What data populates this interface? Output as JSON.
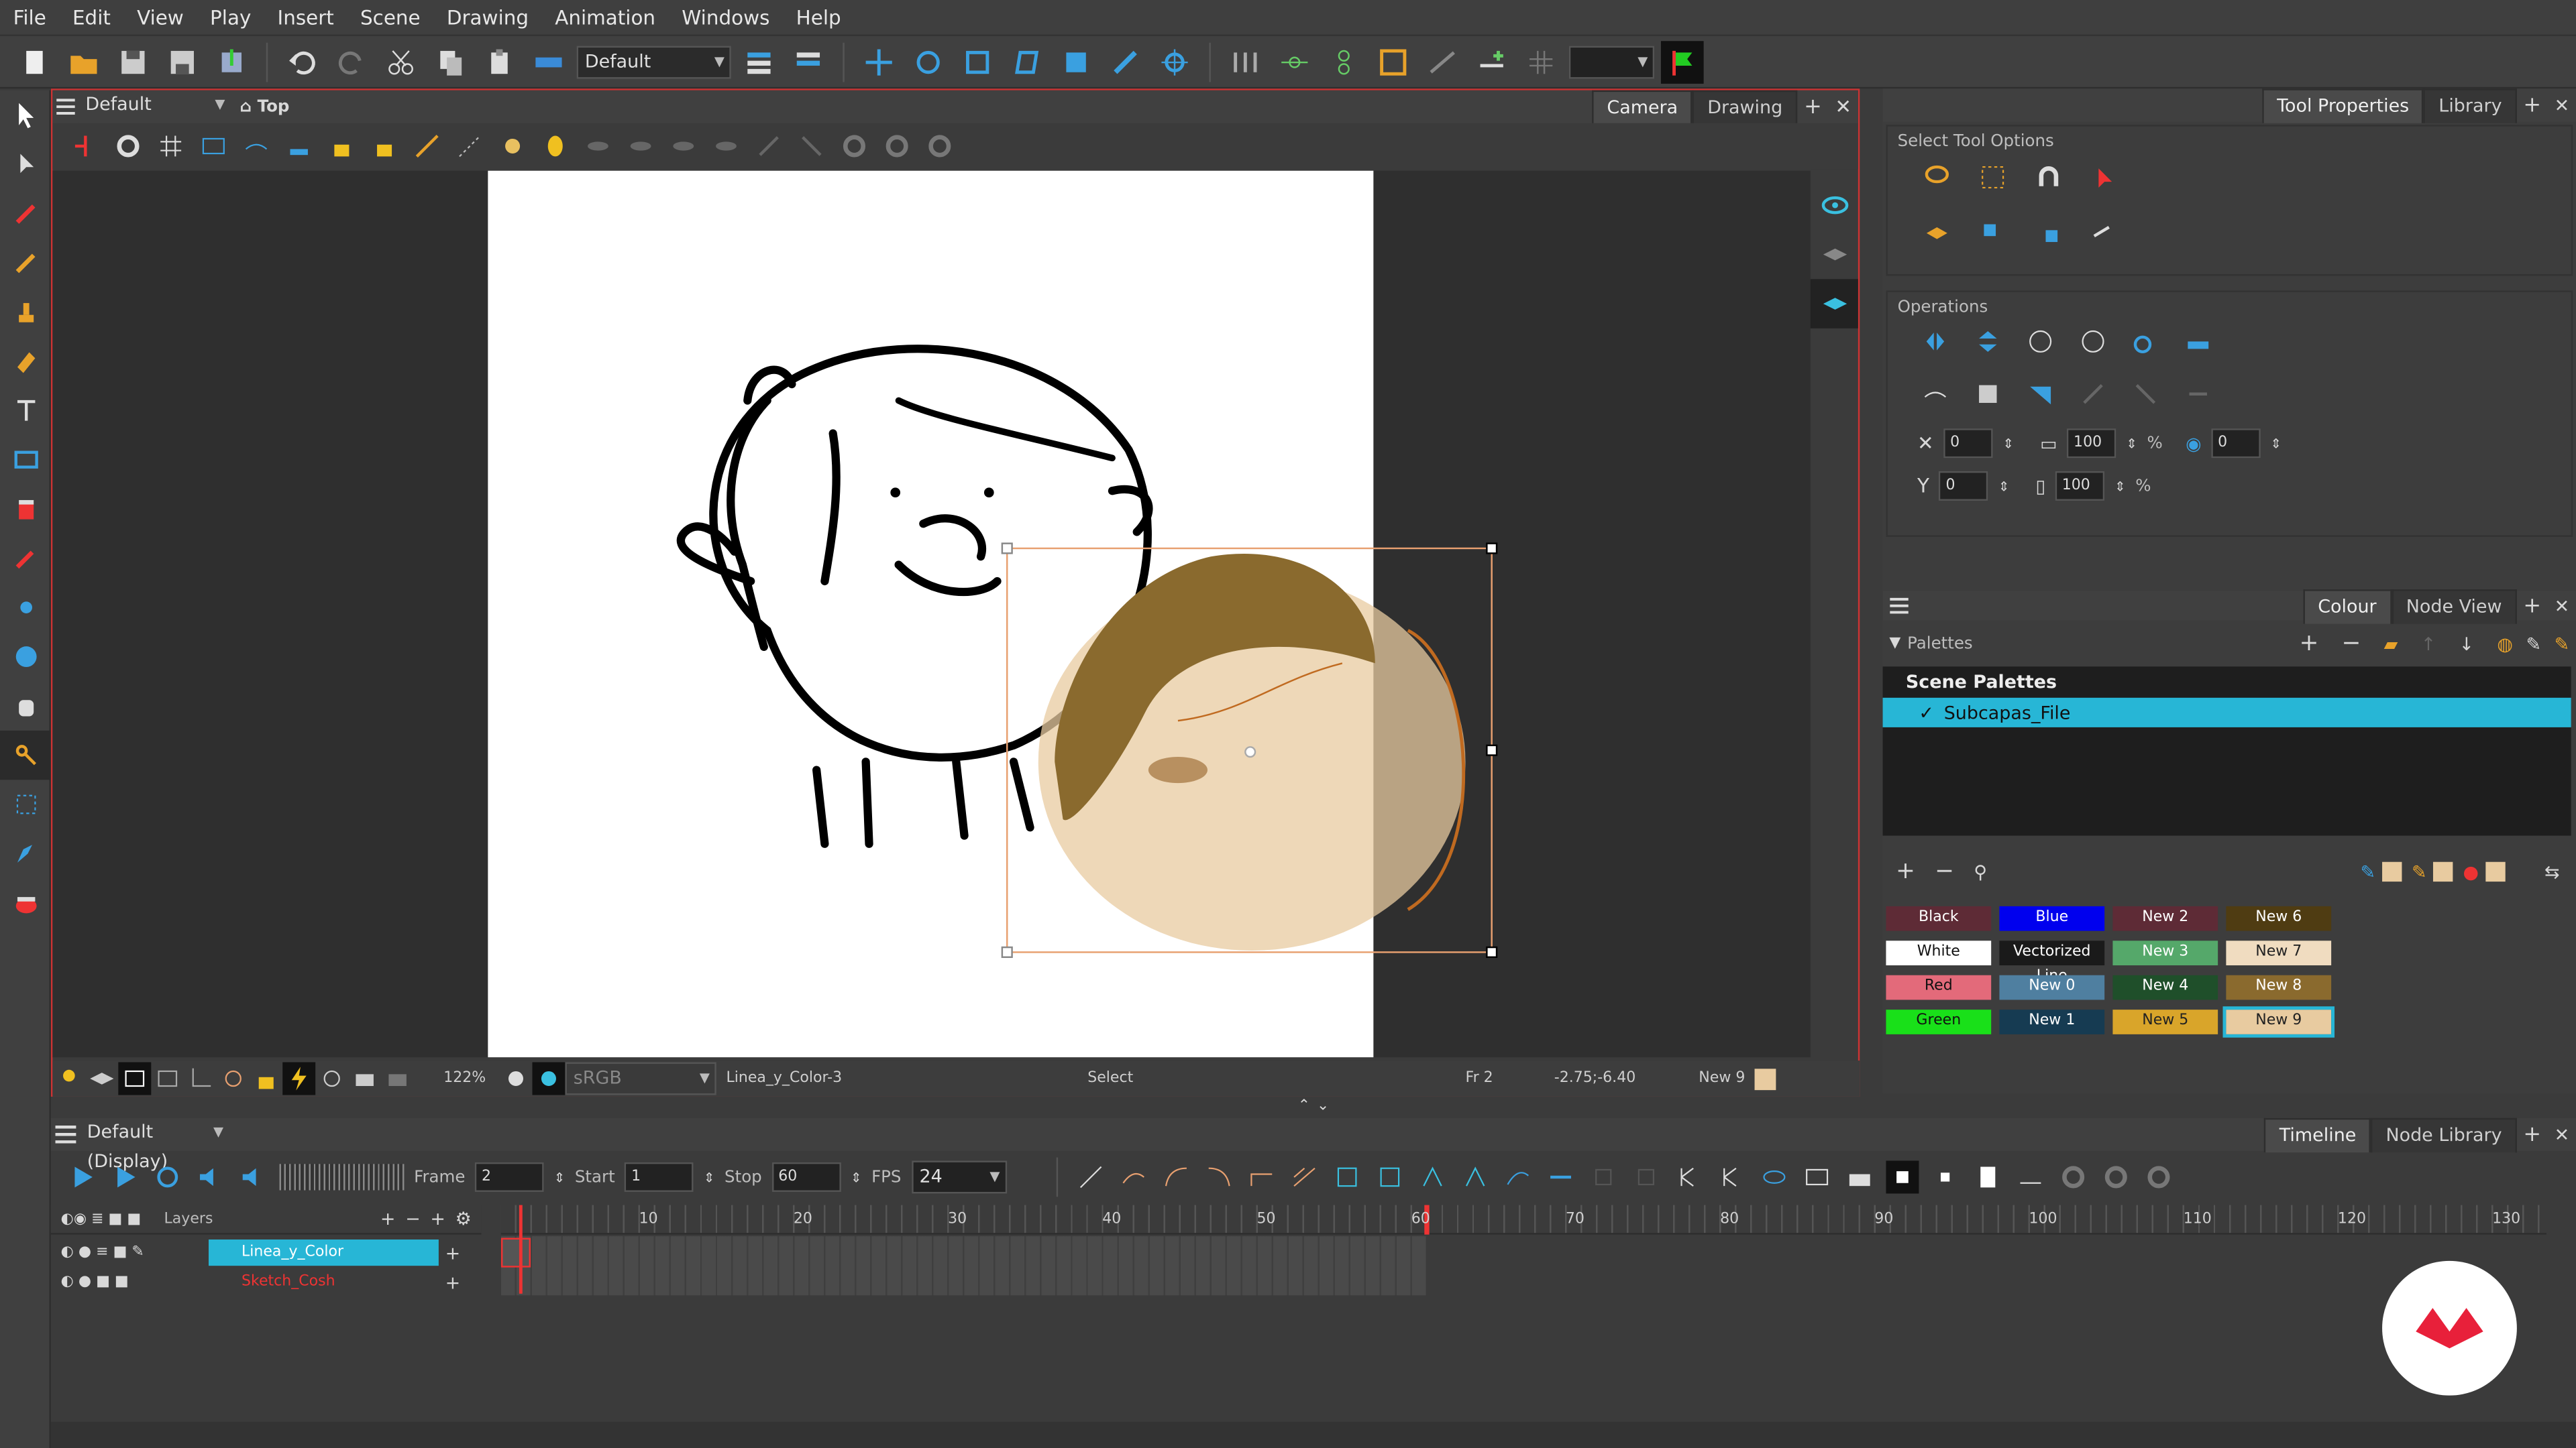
{
  "menu": [
    "File",
    "Edit",
    "View",
    "Play",
    "Insert",
    "Scene",
    "Drawing",
    "Animation",
    "Windows",
    "Help"
  ],
  "toolbar": {
    "workspace": "Default"
  },
  "viewer": {
    "view_dropdown": "Default (Display)",
    "view_mode": "Top",
    "tabs": [
      "Camera",
      "Drawing"
    ]
  },
  "status": {
    "zoom": "122%",
    "color_space": "sRGB",
    "drawing": "Linea_y_Color-3",
    "tool": "Select",
    "frame": "Fr 2",
    "coords": "-2.75;-6.40",
    "color": "New 9",
    "color_hex": "#e8cba0"
  },
  "tool_props": {
    "tabs": [
      "Tool Properties",
      "Library"
    ],
    "section1": "Select Tool Options",
    "section2": "Operations",
    "x": "0",
    "y": "0",
    "w": "100",
    "h": "100",
    "rot": "0",
    "pct": "%"
  },
  "colour": {
    "tabs": [
      "Colour",
      "Node View"
    ],
    "palettes_label": "Palettes",
    "scene_palettes": "Scene Palettes",
    "palette_item": "Subcapas_File",
    "swatches": [
      {
        "label": "Black",
        "bg": "#5e2b36",
        "fg": "#ffffff"
      },
      {
        "label": "Blue",
        "bg": "#0000ee",
        "fg": "#ffffff"
      },
      {
        "label": "New 2",
        "bg": "#5e2b36",
        "fg": "#ffffff"
      },
      {
        "label": "New 6",
        "bg": "#4f3c12",
        "fg": "#ffffff"
      },
      {
        "label": "White",
        "bg": "#ffffff",
        "fg": "#111111"
      },
      {
        "label": "Vectorized Line",
        "bg": "#1a1a1a",
        "fg": "#ffffff"
      },
      {
        "label": "New 3",
        "bg": "#55a86a",
        "fg": "#ffffff"
      },
      {
        "label": "New 7",
        "bg": "#f0dcc0",
        "fg": "#222222"
      },
      {
        "label": "Red",
        "bg": "#e36a7a",
        "fg": "#111111"
      },
      {
        "label": "New 0",
        "bg": "#4f7fa0",
        "fg": "#ffffff"
      },
      {
        "label": "New 4",
        "bg": "#1f4f2a",
        "fg": "#ffffff"
      },
      {
        "label": "New 8",
        "bg": "#8a6a2e",
        "fg": "#ffffff"
      },
      {
        "label": "Green",
        "bg": "#19e019",
        "fg": "#111111"
      },
      {
        "label": "New 1",
        "bg": "#163b52",
        "fg": "#ffffff"
      },
      {
        "label": "New 5",
        "bg": "#d9a52a",
        "fg": "#222222"
      },
      {
        "label": "New 9",
        "bg": "#e8cba0",
        "fg": "#222222"
      }
    ]
  },
  "timeline": {
    "tabs": [
      "Timeline",
      "Node Library"
    ],
    "view": "Default (Display)",
    "frame_label": "Frame",
    "frame": "2",
    "start_label": "Start",
    "start": "1",
    "stop_label": "Stop",
    "stop": "60",
    "fps_label": "FPS",
    "fps": "24",
    "layers_label": "Layers",
    "layers": [
      {
        "name": "Linea_y_Color",
        "selected": true
      },
      {
        "name": "Sketch_Cosh",
        "selected": false
      }
    ],
    "ruler": [
      "10",
      "20",
      "30",
      "40",
      "50",
      "60",
      "70",
      "80",
      "90",
      "100",
      "110",
      "120",
      "130"
    ]
  }
}
